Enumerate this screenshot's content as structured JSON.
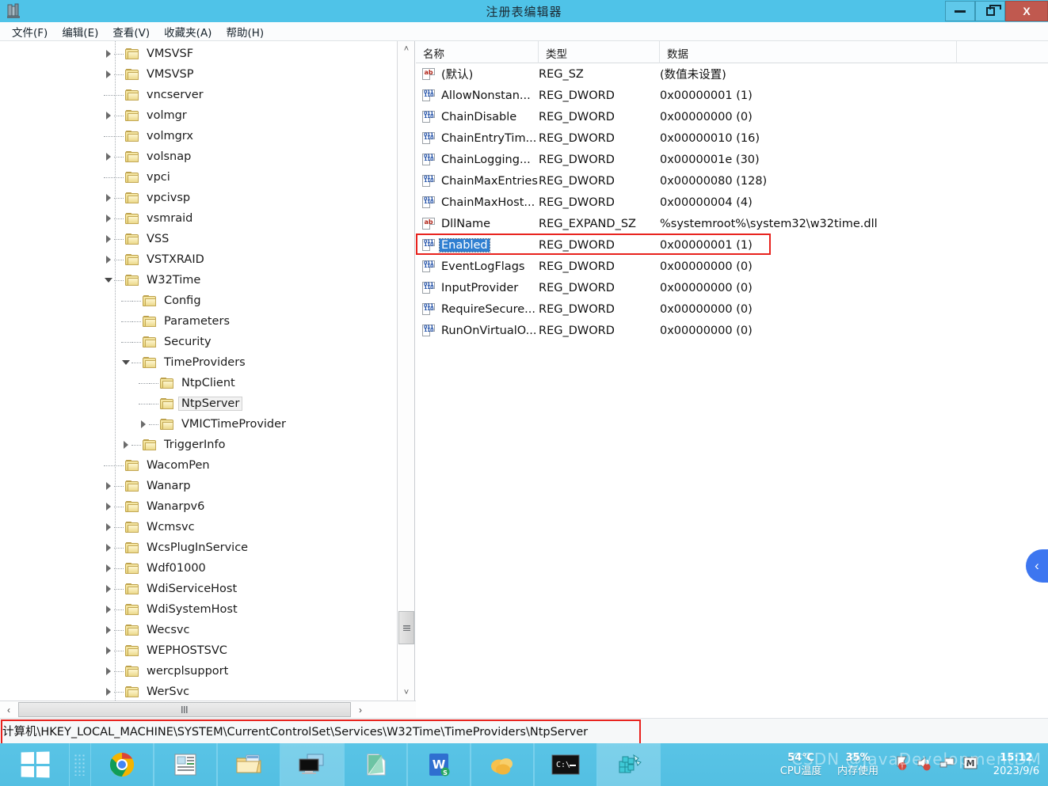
{
  "window": {
    "title": "注册表编辑器",
    "app_icon": "registry-editor-icon",
    "controls": {
      "minimize": "–",
      "maximize": "❐",
      "close": "X"
    }
  },
  "menu": [
    {
      "label": "文件(F)"
    },
    {
      "label": "编辑(E)"
    },
    {
      "label": "查看(V)"
    },
    {
      "label": "收藏夹(A)"
    },
    {
      "label": "帮助(H)"
    }
  ],
  "tree": {
    "nodes": [
      {
        "label": "VMSVSF",
        "indent": 0,
        "expander": "closed",
        "selected": false
      },
      {
        "label": "VMSVSP",
        "indent": 0,
        "expander": "closed",
        "selected": false
      },
      {
        "label": "vncserver",
        "indent": 0,
        "expander": "none",
        "selected": false
      },
      {
        "label": "volmgr",
        "indent": 0,
        "expander": "closed",
        "selected": false
      },
      {
        "label": "volmgrx",
        "indent": 0,
        "expander": "none",
        "selected": false
      },
      {
        "label": "volsnap",
        "indent": 0,
        "expander": "closed",
        "selected": false
      },
      {
        "label": "vpci",
        "indent": 0,
        "expander": "none",
        "selected": false
      },
      {
        "label": "vpcivsp",
        "indent": 0,
        "expander": "closed",
        "selected": false
      },
      {
        "label": "vsmraid",
        "indent": 0,
        "expander": "closed",
        "selected": false
      },
      {
        "label": "VSS",
        "indent": 0,
        "expander": "closed",
        "selected": false
      },
      {
        "label": "VSTXRAID",
        "indent": 0,
        "expander": "closed",
        "selected": false
      },
      {
        "label": "W32Time",
        "indent": 0,
        "expander": "open",
        "selected": false
      },
      {
        "label": "Config",
        "indent": 1,
        "expander": "none",
        "selected": false
      },
      {
        "label": "Parameters",
        "indent": 1,
        "expander": "none",
        "selected": false
      },
      {
        "label": "Security",
        "indent": 1,
        "expander": "none",
        "selected": false
      },
      {
        "label": "TimeProviders",
        "indent": 1,
        "expander": "open",
        "selected": false
      },
      {
        "label": "NtpClient",
        "indent": 2,
        "expander": "none",
        "selected": false
      },
      {
        "label": "NtpServer",
        "indent": 2,
        "expander": "none",
        "selected": true
      },
      {
        "label": "VMICTimeProvider",
        "indent": 2,
        "expander": "closed",
        "selected": false
      },
      {
        "label": "TriggerInfo",
        "indent": 1,
        "expander": "closed",
        "selected": false
      },
      {
        "label": "WacomPen",
        "indent": 0,
        "expander": "none",
        "selected": false
      },
      {
        "label": "Wanarp",
        "indent": 0,
        "expander": "closed",
        "selected": false
      },
      {
        "label": "Wanarpv6",
        "indent": 0,
        "expander": "closed",
        "selected": false
      },
      {
        "label": "Wcmsvc",
        "indent": 0,
        "expander": "closed",
        "selected": false
      },
      {
        "label": "WcsPlugInService",
        "indent": 0,
        "expander": "closed",
        "selected": false
      },
      {
        "label": "Wdf01000",
        "indent": 0,
        "expander": "closed",
        "selected": false
      },
      {
        "label": "WdiServiceHost",
        "indent": 0,
        "expander": "closed",
        "selected": false
      },
      {
        "label": "WdiSystemHost",
        "indent": 0,
        "expander": "closed",
        "selected": false
      },
      {
        "label": "Wecsvc",
        "indent": 0,
        "expander": "closed",
        "selected": false
      },
      {
        "label": "WEPHOSTSVC",
        "indent": 0,
        "expander": "closed",
        "selected": false
      },
      {
        "label": "wercplsupport",
        "indent": 0,
        "expander": "closed",
        "selected": false
      },
      {
        "label": "WerSvc",
        "indent": 0,
        "expander": "closed",
        "selected": false
      }
    ]
  },
  "list": {
    "columns": [
      {
        "label": "名称"
      },
      {
        "label": "类型"
      },
      {
        "label": "数据"
      }
    ],
    "rows": [
      {
        "icon": "ab",
        "name": "(默认)",
        "type": "REG_SZ",
        "data": "(数值未设置)",
        "selected": false
      },
      {
        "icon": "bin",
        "name": "AllowNonstan...",
        "type": "REG_DWORD",
        "data": "0x00000001 (1)",
        "selected": false
      },
      {
        "icon": "bin",
        "name": "ChainDisable",
        "type": "REG_DWORD",
        "data": "0x00000000 (0)",
        "selected": false
      },
      {
        "icon": "bin",
        "name": "ChainEntryTim...",
        "type": "REG_DWORD",
        "data": "0x00000010 (16)",
        "selected": false
      },
      {
        "icon": "bin",
        "name": "ChainLogging...",
        "type": "REG_DWORD",
        "data": "0x0000001e (30)",
        "selected": false
      },
      {
        "icon": "bin",
        "name": "ChainMaxEntries",
        "type": "REG_DWORD",
        "data": "0x00000080 (128)",
        "selected": false
      },
      {
        "icon": "bin",
        "name": "ChainMaxHost...",
        "type": "REG_DWORD",
        "data": "0x00000004 (4)",
        "selected": false
      },
      {
        "icon": "ab",
        "name": "DllName",
        "type": "REG_EXPAND_SZ",
        "data": "%systemroot%\\system32\\w32time.dll",
        "selected": false
      },
      {
        "icon": "bin",
        "name": "Enabled",
        "type": "REG_DWORD",
        "data": "0x00000001 (1)",
        "selected": true
      },
      {
        "icon": "bin",
        "name": "EventLogFlags",
        "type": "REG_DWORD",
        "data": "0x00000000 (0)",
        "selected": false
      },
      {
        "icon": "bin",
        "name": "InputProvider",
        "type": "REG_DWORD",
        "data": "0x00000000 (0)",
        "selected": false
      },
      {
        "icon": "bin",
        "name": "RequireSecure...",
        "type": "REG_DWORD",
        "data": "0x00000000 (0)",
        "selected": false
      },
      {
        "icon": "bin",
        "name": "RunOnVirtualO...",
        "type": "REG_DWORD",
        "data": "0x00000000 (0)",
        "selected": false
      }
    ]
  },
  "scrollbars": {
    "left_arrow": "‹",
    "right_arrow": "›",
    "up_arrow": "˄",
    "down_arrow": "˅"
  },
  "statusbar": {
    "path": "计算机\\HKEY_LOCAL_MACHINE\\SYSTEM\\CurrentControlSet\\Services\\W32Time\\TimeProviders\\NtpServer"
  },
  "edge_tab": {
    "icon": "chevron-left-icon",
    "glyph": "‹"
  },
  "taskbar": {
    "start": "windows-start-icon",
    "items": [
      {
        "icon": "chrome-icon",
        "active": false
      },
      {
        "icon": "notepad-doc-icon",
        "active": false
      },
      {
        "icon": "file-explorer-icon",
        "active": false
      },
      {
        "icon": "remote-desktop-icon",
        "active": true
      },
      {
        "icon": "green-app-icon",
        "active": false
      },
      {
        "icon": "wps-writer-icon",
        "active": false
      },
      {
        "icon": "orange-cloud-icon",
        "active": false
      },
      {
        "icon": "command-prompt-icon",
        "active": false
      },
      {
        "icon": "registry-editor-icon",
        "active": true
      }
    ],
    "tray": {
      "cpu_temp_value": "54℃",
      "cpu_temp_label": "CPU温度",
      "mem_value": "35%",
      "mem_label": "内存使用",
      "icons": [
        "flag-icon",
        "speaker-icon",
        "network-icon",
        "letter-m-icon"
      ],
      "time": "15:12",
      "date": "2023/9/6"
    }
  },
  "watermark": "CSDN @JavaDevelopmentDM",
  "colors": {
    "title_bar": "#4fc3e8",
    "close_button": "#c0594f",
    "selection": "#2f7fd1",
    "highlight_box": "#e8221d",
    "taskbar": "#53bfe2",
    "edge_tab": "#3d76f0"
  }
}
